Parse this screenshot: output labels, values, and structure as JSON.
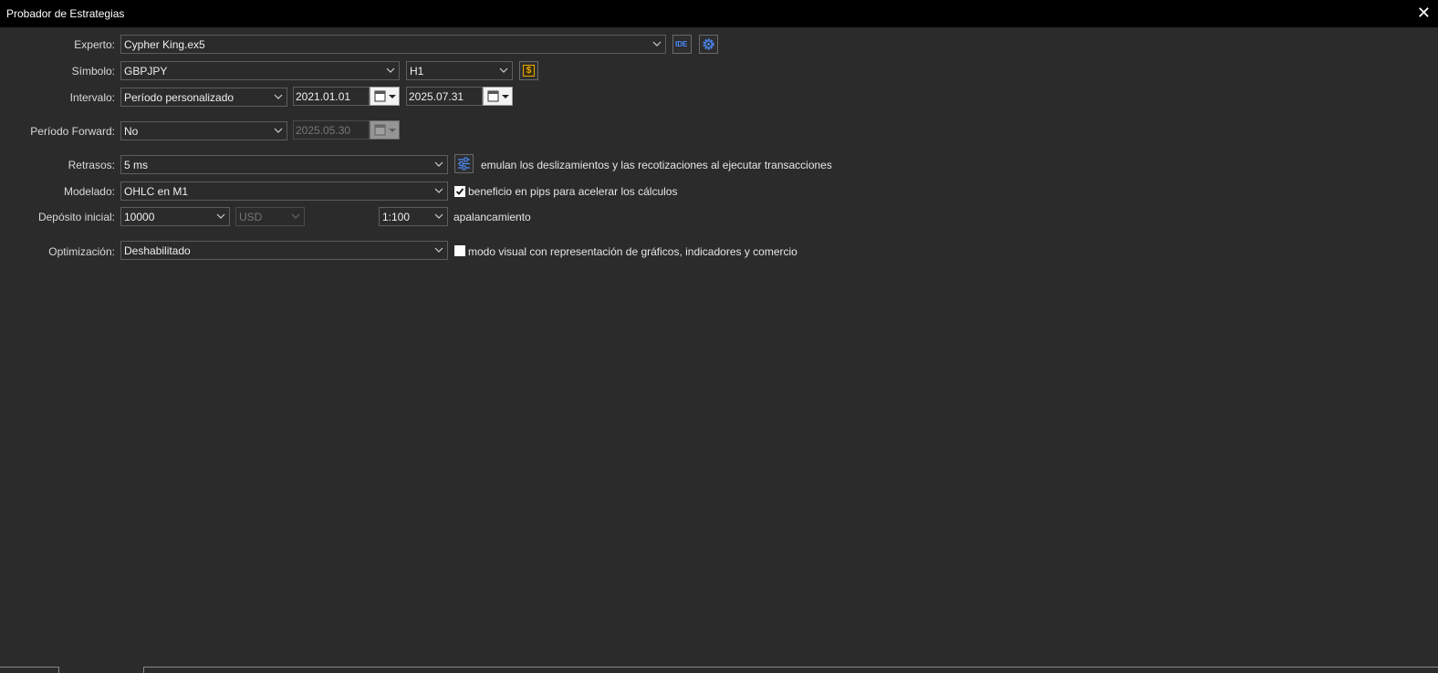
{
  "window": {
    "title": "Probador de Estrategias",
    "close_glyph": "✕"
  },
  "form": {
    "experto": {
      "label": "Experto:",
      "value": "Cypher King.ex5"
    },
    "simbolo": {
      "label": "Símbolo:",
      "value": "GBPJPY",
      "timeframe": "H1"
    },
    "intervalo": {
      "label": "Intervalo:",
      "value": "Período personalizado",
      "from": "2021.01.01",
      "to": "2025.07.31"
    },
    "forward": {
      "label": "Período Forward:",
      "value": "No",
      "date": "2025.05.30"
    },
    "retrasos": {
      "label": "Retrasos:",
      "value": "5 ms",
      "note": "emulan los deslizamientos y las recotizaciones al ejecutar transacciones"
    },
    "modelado": {
      "label": "Modelado:",
      "value": "OHLC en M1",
      "checkbox_label": "beneficio en pips para acelerar los cálculos",
      "checked": true
    },
    "deposito": {
      "label": "Depósito inicial:",
      "value": "10000",
      "currency": "USD",
      "leverage": "1:100",
      "leverage_label": "apalancamiento"
    },
    "optimizacion": {
      "label": "Optimización:",
      "value": "Deshabilitado",
      "checkbox_label": "modo visual con representación de gráficos, indicadores y comercio",
      "checked": false
    }
  },
  "icons": {
    "ide": "IDE",
    "settings": "gear-icon",
    "symbol": "$",
    "delays": "sliders-icon",
    "calendar": "calendar-icon"
  },
  "colors": {
    "background": "#2b2b2b",
    "titlebar": "#000000",
    "accent_blue": "#4c8dff",
    "accent_orange": "#e6a700"
  }
}
